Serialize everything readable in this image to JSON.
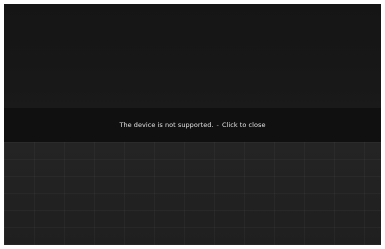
{
  "notification": {
    "message": "The device is not supported.",
    "separator": "-",
    "action": "Click to close"
  },
  "colors": {
    "background": "#1b1b1b",
    "notification_bar": "#101010",
    "notification_text": "#e6e6e6"
  }
}
